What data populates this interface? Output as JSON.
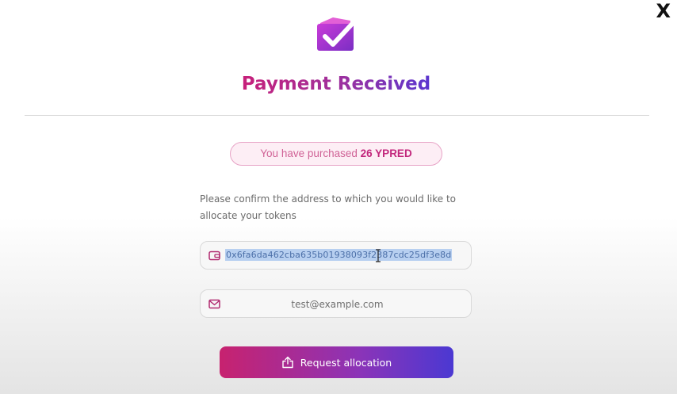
{
  "close_label": "X",
  "header": {
    "title": "Payment Received",
    "icon": "purchase-check-icon"
  },
  "purchase": {
    "prefix": "You have purchased",
    "amount": "26 YPRED"
  },
  "instructions": "Please confirm the address to which you would like to allocate your tokens",
  "wallet": {
    "icon": "wallet-icon",
    "value": "0x6fa6da462cba635b01938093f2387cdc25df3e8d",
    "selected": true
  },
  "email": {
    "icon": "mail-icon",
    "value": "test@example.com"
  },
  "button": {
    "label": "Request allocation",
    "icon": "upload-icon"
  },
  "colors": {
    "brand_pink": "#c7207a",
    "brand_purple": "#5b36cf",
    "badge_bg": "#fdeef5",
    "selection": "#b7cff0"
  }
}
